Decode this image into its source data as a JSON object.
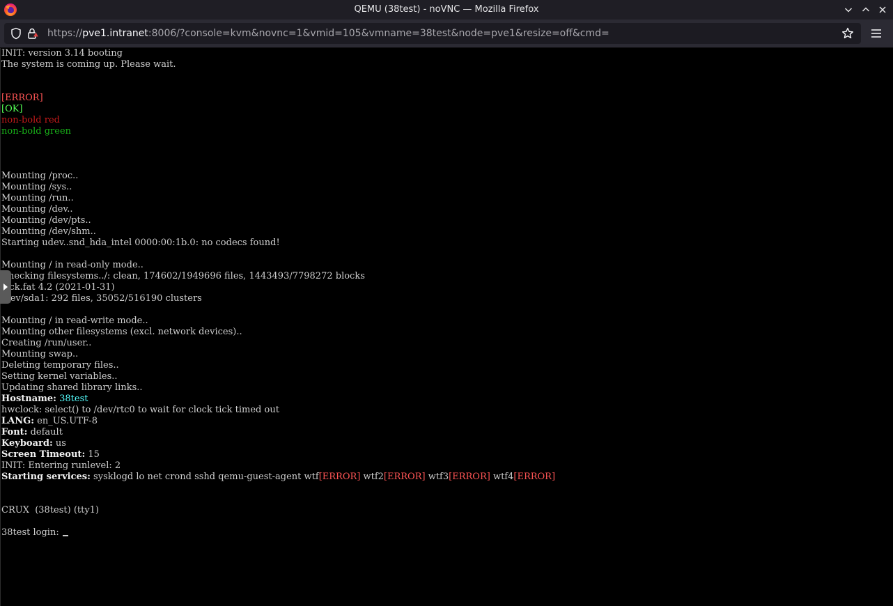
{
  "window": {
    "title": "QEMU (38test) - noVNC — Mozilla Firefox",
    "icons": [
      "firefox-icon",
      "minimize-icon",
      "maximize-icon",
      "close-icon"
    ]
  },
  "navbar": {
    "url_prefix": "https://",
    "url_host": "pve1.intranet",
    "url_rest": ":8006/?console=kvm&novnc=1&vmid=105&vmname=38test&node=pve1&resize=off&cmd=",
    "icons": [
      "shield-icon",
      "lock-icon",
      "bookmark-star-icon",
      "hamburger-menu-icon"
    ]
  },
  "terminal": {
    "colors": {
      "error": "#ff5555",
      "ok": "#55ff55",
      "red": "#c41a1a",
      "green": "#19b419",
      "cyan": "#55ffff"
    },
    "lines": [
      [
        {
          "t": "INIT: version 3.14 booting"
        }
      ],
      [
        {
          "t": "The system is coming up. Please wait."
        }
      ],
      [],
      [],
      [
        {
          "t": "[ERROR]",
          "c": "err"
        }
      ],
      [
        {
          "t": "[OK]",
          "c": "ok"
        }
      ],
      [
        {
          "t": "non-bold red",
          "c": "red"
        }
      ],
      [
        {
          "t": "non-bold green",
          "c": "green"
        }
      ],
      [],
      [],
      [],
      [
        {
          "t": "Mounting /proc.."
        }
      ],
      [
        {
          "t": "Mounting /sys.."
        }
      ],
      [
        {
          "t": "Mounting /run.."
        }
      ],
      [
        {
          "t": "Mounting /dev.."
        }
      ],
      [
        {
          "t": "Mounting /dev/pts.."
        }
      ],
      [
        {
          "t": "Mounting /dev/shm.."
        }
      ],
      [
        {
          "t": "Starting udev..snd_hda_intel 0000:00:1b.0: no codecs found!"
        }
      ],
      [],
      [
        {
          "t": "Mounting / in read-only mode.."
        }
      ],
      [
        {
          "t": "Checking filesystems../: clean, 174602/1949696 files, 1443493/7798272 blocks"
        }
      ],
      [
        {
          "t": "fsck.fat 4.2 (2021-01-31)"
        }
      ],
      [
        {
          "t": "/dev/sda1: 292 files, 35052/516190 clusters"
        }
      ],
      [],
      [
        {
          "t": "Mounting / in read-write mode.."
        }
      ],
      [
        {
          "t": "Mounting other filesystems (excl. network devices).."
        }
      ],
      [
        {
          "t": "Creating /run/user.."
        }
      ],
      [
        {
          "t": "Mounting swap.."
        }
      ],
      [
        {
          "t": "Deleting temporary files.."
        }
      ],
      [
        {
          "t": "Setting kernel variables.."
        }
      ],
      [
        {
          "t": "Updating shared library links.."
        }
      ],
      [
        {
          "t": "Hostname:",
          "c": "b"
        },
        {
          "t": " "
        },
        {
          "t": "38test",
          "c": "cyan"
        }
      ],
      [
        {
          "t": "hwclock: select() to /dev/rtc0 to wait for clock tick timed out"
        }
      ],
      [
        {
          "t": "LANG:",
          "c": "b"
        },
        {
          "t": " en_US.UTF-8"
        }
      ],
      [
        {
          "t": "Font:",
          "c": "b"
        },
        {
          "t": " default"
        }
      ],
      [
        {
          "t": "Keyboard:",
          "c": "b"
        },
        {
          "t": " us"
        }
      ],
      [
        {
          "t": "Screen Timeout:",
          "c": "b"
        },
        {
          "t": " 15"
        }
      ],
      [
        {
          "t": "INIT: Entering runlevel: 2"
        }
      ],
      [
        {
          "t": "Starting services:",
          "c": "b"
        },
        {
          "t": " sysklogd lo net crond sshd qemu-guest-agent wtf"
        },
        {
          "t": "[ERROR]",
          "c": "err"
        },
        {
          "t": " wtf2"
        },
        {
          "t": "[ERROR]",
          "c": "err"
        },
        {
          "t": " wtf3"
        },
        {
          "t": "[ERROR]",
          "c": "err"
        },
        {
          "t": " wtf4"
        },
        {
          "t": "[ERROR]",
          "c": "err"
        }
      ],
      [],
      [],
      [
        {
          "t": "CRUX  (38test) (tty1)"
        }
      ],
      [],
      [
        {
          "t": "38test login: "
        },
        {
          "cursor": true
        }
      ]
    ]
  },
  "novnc": {
    "handle_icon": "expand-arrow-icon"
  }
}
